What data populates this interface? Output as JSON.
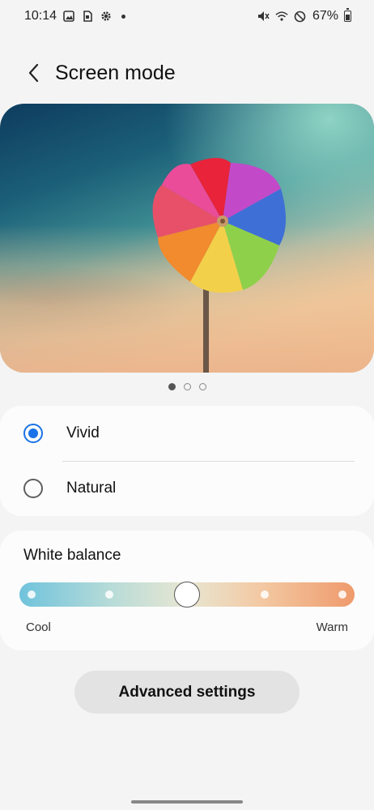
{
  "status_bar": {
    "time": "10:14",
    "battery": "67%",
    "left_icons": [
      "gallery-icon",
      "sim-card-icon",
      "settings-gear-icon",
      "dot-icon"
    ],
    "right_icons": [
      "vibrate-mute-icon",
      "wifi-icon",
      "do-not-disturb-icon",
      "battery-icon"
    ]
  },
  "header": {
    "title": "Screen mode",
    "back_icon": "chevron-left-icon"
  },
  "preview": {
    "description_icon": "pinwheel-image",
    "pages": 3,
    "active_page": 1
  },
  "screen_modes": {
    "options": [
      {
        "label": "Vivid",
        "selected": true
      },
      {
        "label": "Natural",
        "selected": false
      }
    ]
  },
  "white_balance": {
    "title": "White balance",
    "min_label": "Cool",
    "max_label": "Warm",
    "steps": 5,
    "value": 3
  },
  "advanced": {
    "label": "Advanced settings"
  },
  "colors": {
    "accent": "#1a73e8",
    "background": "#f4f4f4",
    "card": "#fcfcfc"
  }
}
